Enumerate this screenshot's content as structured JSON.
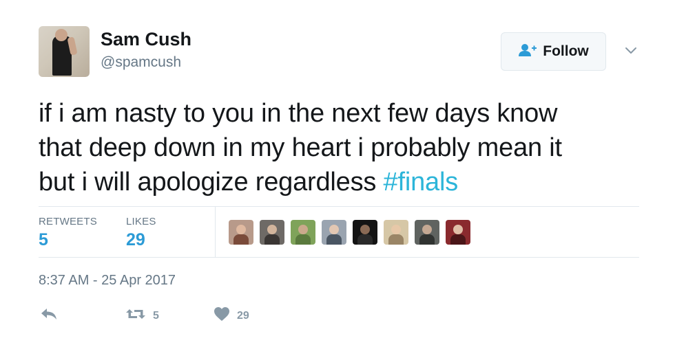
{
  "user": {
    "display_name": "Sam Cush",
    "handle": "@spamcush",
    "avatar_icon": "profile-photo"
  },
  "follow_button": {
    "label": "Follow",
    "icon": "add-user-icon"
  },
  "menu": {
    "icon": "chevron-down-icon"
  },
  "tweet": {
    "lines": [
      "if i am nasty to you in the next few days know",
      "that deep down in my heart i probably mean it",
      "but i will apologize regardless "
    ],
    "hashtag": "#finals"
  },
  "stats": {
    "retweets_label": "RETWEETS",
    "retweets_count": "5",
    "likes_label": "LIKES",
    "likes_count": "29"
  },
  "likers": [
    {
      "name": "liker-1",
      "bg": "#b89a8a",
      "head": "#e0b9a0",
      "body": "#7a4b3a"
    },
    {
      "name": "liker-2",
      "bg": "#6e6a66",
      "head": "#d2b49c",
      "body": "#3a3634"
    },
    {
      "name": "liker-3",
      "bg": "#7fa35a",
      "head": "#caa98c",
      "body": "#5a7a3e"
    },
    {
      "name": "liker-4",
      "bg": "#9aa4b0",
      "head": "#e2c7b3",
      "body": "#4a5663"
    },
    {
      "name": "liker-5",
      "bg": "#141414",
      "head": "#8a6a55",
      "body": "#2a2a2a"
    },
    {
      "name": "liker-6",
      "bg": "#d6c7a6",
      "head": "#e7c8a8",
      "body": "#9a8566"
    },
    {
      "name": "liker-7",
      "bg": "#5f6360",
      "head": "#c4a893",
      "body": "#303331"
    },
    {
      "name": "liker-8",
      "bg": "#8a2a2e",
      "head": "#e0bfa8",
      "body": "#4a1618"
    }
  ],
  "timestamp": "8:37 AM - 25 Apr 2017",
  "actions": {
    "reply_icon": "reply-icon",
    "retweet_icon": "retweet-icon",
    "retweet_count": "5",
    "like_icon": "heart-icon",
    "like_count": "29"
  },
  "colors": {
    "accent": "#2c9bd6",
    "hashtag": "#2cb5d9",
    "muted": "#657786",
    "action_gray": "#8899a6"
  }
}
